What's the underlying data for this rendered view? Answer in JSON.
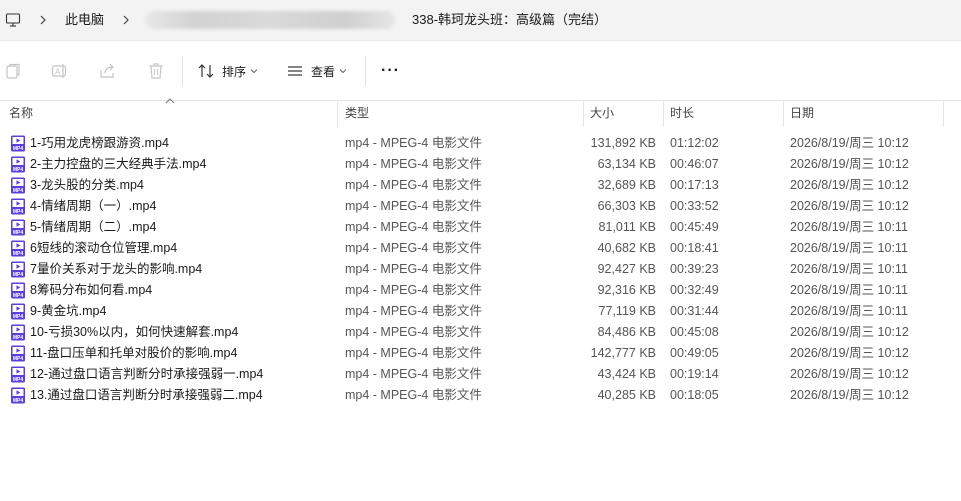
{
  "address_bar": {
    "crumbs": [
      "此电脑",
      "338-韩珂龙头班：高级篇（完结）"
    ]
  },
  "toolbar": {
    "sort_label": "排序",
    "view_label": "查看",
    "more_label": "···"
  },
  "columns": {
    "name": "名称",
    "type": "类型",
    "size": "大小",
    "duration": "时长",
    "date": "日期"
  },
  "files": [
    {
      "name": "1-巧用龙虎榜跟游资.mp4",
      "type": "mp4 - MPEG-4 电影文件",
      "size": "131,892 KB",
      "duration": "01:12:02",
      "date": "2026/8/19/周三 10:12"
    },
    {
      "name": "2-主力控盘的三大经典手法.mp4",
      "type": "mp4 - MPEG-4 电影文件",
      "size": "63,134 KB",
      "duration": "00:46:07",
      "date": "2026/8/19/周三 10:12"
    },
    {
      "name": "3-龙头股的分类.mp4",
      "type": "mp4 - MPEG-4 电影文件",
      "size": "32,689 KB",
      "duration": "00:17:13",
      "date": "2026/8/19/周三 10:12"
    },
    {
      "name": "4-情绪周期（一）.mp4",
      "type": "mp4 - MPEG-4 电影文件",
      "size": "66,303 KB",
      "duration": "00:33:52",
      "date": "2026/8/19/周三 10:12"
    },
    {
      "name": "5-情绪周期（二）.mp4",
      "type": "mp4 - MPEG-4 电影文件",
      "size": "81,011 KB",
      "duration": "00:45:49",
      "date": "2026/8/19/周三 10:11"
    },
    {
      "name": "6短线的滚动仓位管理.mp4",
      "type": "mp4 - MPEG-4 电影文件",
      "size": "40,682 KB",
      "duration": "00:18:41",
      "date": "2026/8/19/周三 10:11"
    },
    {
      "name": "7量价关系对于龙头的影响.mp4",
      "type": "mp4 - MPEG-4 电影文件",
      "size": "92,427 KB",
      "duration": "00:39:23",
      "date": "2026/8/19/周三 10:11"
    },
    {
      "name": "8筹码分布如何看.mp4",
      "type": "mp4 - MPEG-4 电影文件",
      "size": "92,316 KB",
      "duration": "00:32:49",
      "date": "2026/8/19/周三 10:11"
    },
    {
      "name": "9-黄金坑.mp4",
      "type": "mp4 - MPEG-4 电影文件",
      "size": "77,119 KB",
      "duration": "00:31:44",
      "date": "2026/8/19/周三 10:11"
    },
    {
      "name": "10-亏损30%以内，如何快速解套.mp4",
      "type": "mp4 - MPEG-4 电影文件",
      "size": "84,486 KB",
      "duration": "00:45:08",
      "date": "2026/8/19/周三 10:12"
    },
    {
      "name": "11-盘口压单和托单对股价的影响.mp4",
      "type": "mp4 - MPEG-4 电影文件",
      "size": "142,777 KB",
      "duration": "00:49:05",
      "date": "2026/8/19/周三 10:12"
    },
    {
      "name": "12-通过盘口语言判断分时承接强弱一.mp4",
      "type": "mp4 - MPEG-4 电影文件",
      "size": "43,424 KB",
      "duration": "00:19:14",
      "date": "2026/8/19/周三 10:12"
    },
    {
      "name": "13.通过盘口语言判断分时承接强弱二.mp4",
      "type": "mp4 - MPEG-4 电影文件",
      "size": "40,285 KB",
      "duration": "00:18:05",
      "date": "2026/8/19/周三 10:12"
    }
  ],
  "icons": {
    "computer": "computer-icon",
    "file": "mp4-file-icon"
  },
  "colors": {
    "file_icon": "#5b3fd6"
  }
}
